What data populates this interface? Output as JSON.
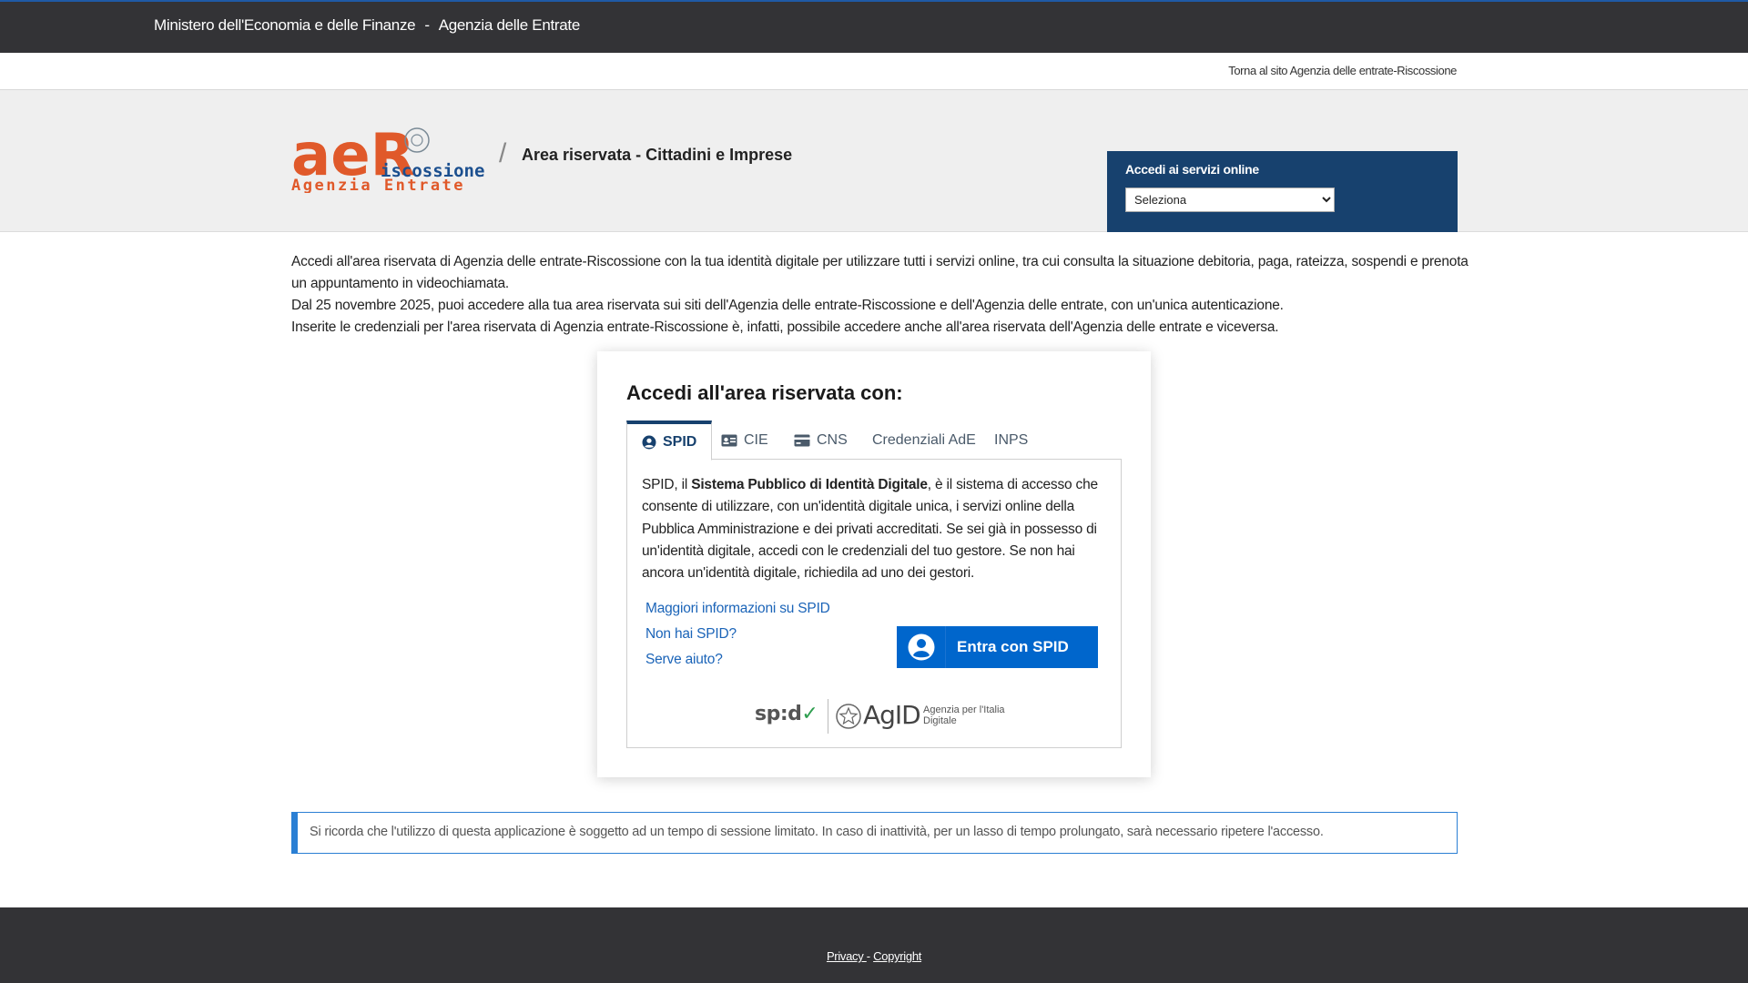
{
  "top_bar": {
    "ministry": "Ministero dell'Economia e delle Finanze",
    "separator": "-",
    "agency": "Agenzia delle Entrate"
  },
  "sub_bar": {
    "back_link": "Torna al sito Agenzia delle entrate-Riscossione"
  },
  "header": {
    "logo_letters": "aeR",
    "logo_word1": "iscossione",
    "logo_word2": "Agenzia Entrate",
    "slash": "/",
    "area_title": "Area riservata - Cittadini e Imprese",
    "access_label": "Accedi ai servizi online",
    "access_select_value": "Seleziona"
  },
  "intro": {
    "line1": "Accedi all'area riservata di Agenzia delle entrate-Riscossione con la tua identità digitale per utilizzare tutti i servizi online, tra cui consulta la situazione debitoria, paga, rateizza, sospendi e prenota un appuntamento in videochiamata.",
    "line2": "Dal 25 novembre 2025, puoi accedere alla tua area riservata sui siti dell'Agenzia delle entrate-Riscossione e dell'Agenzia delle entrate, con un'unica autenticazione.",
    "line3": "Inserite le credenziali per l'area riservata di Agenzia entrate-Riscossione è, infatti, possibile accedere anche all'area riservata dell'Agenzia delle entrate e viceversa."
  },
  "login": {
    "title": "Accedi all'area riservata con:",
    "tabs": [
      "SPID",
      "CIE",
      "CNS",
      "Credenziali AdE",
      "INPS"
    ],
    "active_tab": "SPID",
    "desc_pre": "SPID, il ",
    "desc_bold": "Sistema Pubblico di Identità Digitale",
    "desc_post": ", è il sistema di accesso che consente di utilizzare, con un'identità digitale unica, i servizi online della Pubblica Amministrazione e dei privati accreditati. Se sei già in possesso di un'identità digitale, accedi con le credenziali del tuo gestore. Se non hai ancora un'identità digitale, richiedila ad uno dei gestori.",
    "links": [
      "Maggiori informazioni su SPID",
      "Non hai SPID?",
      "Serve aiuto?"
    ],
    "button": "Entra con SPID",
    "spid_logo": "sp:d",
    "agid": "AgID",
    "agid_sub": "Agenzia per l'Italia Digitale"
  },
  "notice": {
    "text": "Si ricorda che l'utilizzo di questa applicazione è soggetto ad un tempo di sessione limitato. In caso di inattività, per un lasso di tempo prolungato, sarà necessario ripetere l'accesso."
  },
  "footer": {
    "privacy": "Privacy ",
    "separator": "-",
    "copyright": "Copyright"
  },
  "colors": {
    "top_bar": "#333336",
    "header_bg": "#efefef",
    "access_box": "#17416e",
    "spid_button": "#0066cc",
    "link": "#1b64b8",
    "notice_border": "#2a7fd4"
  }
}
